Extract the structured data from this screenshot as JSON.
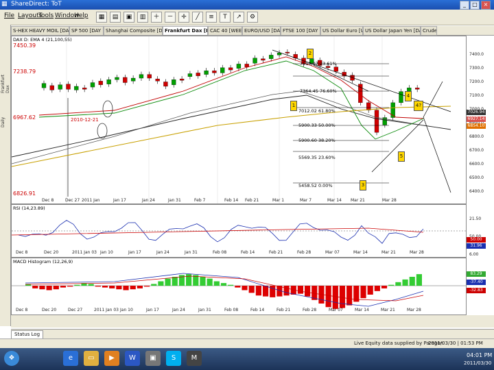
{
  "window": {
    "title": "ShareDirect: ToT",
    "buttons": [
      "_",
      "□",
      "×"
    ]
  },
  "menu": [
    "File",
    "Layouts",
    "Tools",
    "Window",
    "Help"
  ],
  "toolbar_icons": [
    "new-chart-icon",
    "open-icon",
    "save-icon",
    "print-icon",
    "zoom-in-icon",
    "zoom-out-icon",
    "crosshair-icon",
    "draw-line-icon",
    "fib-icon",
    "text-icon",
    "arrow-icon",
    "settings-icon"
  ],
  "tabs": [
    "S-HEX HEAVY MOIL [DAY 1]",
    "SP 500 [DAY 1]",
    "Shanghai Composite [DAY 1]",
    "Frankfurt Dax [DAY 1]",
    "CAC 40 [WEEK 1]",
    "EURO/USD [DAY 1]",
    "FTSE 100 [DAY 1]",
    "US Dollar Euro [WEEK 1]",
    "US Dollar Japan Yen [DAY 1]",
    "Crude"
  ],
  "active_tab": 3,
  "sidebar_labels": [
    "Frankfurt Dax",
    "Daily"
  ],
  "main": {
    "header": "DAX D: EMA 4 (21,100,55)",
    "top_price": "7450.39",
    "price_labels": {
      "high": "7238.79",
      "mid": "6967.62",
      "low": "6826.91"
    },
    "date_note": "2010-12-21",
    "fib": [
      "7519.07 23.61%",
      "7364.45 76.60%",
      "7012.02 61.80%",
      "5900.33 50.00%",
      "5900.60 38.20%",
      "5569.35 23.60%",
      "5458.52 0.00%"
    ],
    "markers": [
      "2",
      "1",
      "3",
      "4",
      "5",
      "4?"
    ],
    "yticks": [
      "7400.0",
      "7300.0",
      "7200.0",
      "7100.0",
      "7000.0",
      "6900.0",
      "6800.0",
      "6700.0",
      "6600.0",
      "6500.0",
      "6400.0"
    ],
    "xticks": [
      "Dec 8",
      "Dec 27",
      "2011 Jan",
      "Jan 17",
      "Jan 24",
      "Jan 31",
      "Feb 7",
      "Feb 14",
      "Feb 21",
      "Mar 1",
      "Mar 7",
      "Mar 14",
      "Mar 21",
      "Mar 28"
    ],
    "price_tags": [
      "7026.94",
      "6927.14",
      "6854.10"
    ]
  },
  "rsi": {
    "header": "RSI (14,23.89)",
    "yticks": [
      "21.50",
      "50.00",
      "6.00"
    ],
    "tags": [
      "50.00",
      "31.96"
    ],
    "xticks": [
      "Dec 8",
      "Dec 20",
      "2011 Jan 03",
      "Jan 10",
      "Jan 17",
      "Jan 24",
      "Jan 31",
      "Feb 08",
      "Feb 14",
      "Feb 21",
      "Feb 28",
      "Mar 07",
      "Mar 14",
      "Mar 21",
      "Mar 28"
    ]
  },
  "macd": {
    "header": "MACD Histogram (12,26,9)",
    "tags": [
      "83.29",
      "-37.40",
      "-32.83"
    ],
    "xticks": [
      "Dec 8",
      "Dec 20",
      "Dec 27",
      "2011 Jan 03",
      "Jan 10",
      "Jan 17",
      "Jan 24",
      "Jan 31",
      "Feb 08",
      "Feb 14",
      "Feb 21",
      "Feb 28",
      "Mar 07",
      "Mar 14",
      "Mar 21",
      "Mar 28"
    ]
  },
  "status_tab": "Status Log",
  "status_text": "Live Equity data supplied by Paragon",
  "status_time": "2011/03/30 | 01:53 PM",
  "taskbar": {
    "icons": [
      "start-orb-icon",
      "ie-icon",
      "folder-icon",
      "media-icon",
      "word-icon",
      "app-icon",
      "skype-icon",
      "tot-icon"
    ],
    "time": "04:01 PM",
    "date": "2011/03/30"
  },
  "colors": {
    "titlebar": "#1a4fb0",
    "up_candle": "#00a000",
    "down_candle": "#d00000",
    "ema_short": "#c00000",
    "ema_mid": "#0a8a0a",
    "ema_long": "#222222",
    "ema_yellow": "#c8a000"
  }
}
